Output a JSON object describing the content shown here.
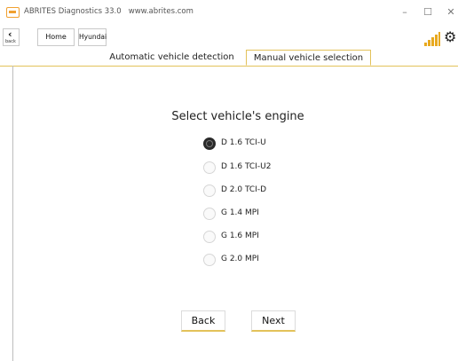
{
  "window": {
    "title": "ABRITES Diagnostics 33.0",
    "url": "www.abrites.com",
    "minimize_glyph": "–",
    "maximize_glyph": "☐",
    "close_glyph": "✕"
  },
  "toolbar": {
    "back_arrow": "‹",
    "back_label": "back",
    "home_label": "Home",
    "make_label": "Hyundai",
    "signal_icon": "signal-strength-icon",
    "settings_glyph": "⚙"
  },
  "tabs": [
    {
      "label": "Automatic vehicle detection",
      "active": false
    },
    {
      "label": "Manual vehicle selection",
      "active": true
    }
  ],
  "main": {
    "heading": "Select vehicle's engine",
    "options": [
      {
        "label": "D 1.6 TCI-U",
        "selected": true
      },
      {
        "label": "D 1.6 TCI-U2",
        "selected": false
      },
      {
        "label": "D 2.0 TCI-D",
        "selected": false
      },
      {
        "label": "G 1.4 MPI",
        "selected": false
      },
      {
        "label": "G 1.6 MPI",
        "selected": false
      },
      {
        "label": "G 2.0 MPI",
        "selected": false
      }
    ],
    "back_button": "Back",
    "next_button": "Next"
  },
  "colors": {
    "accent": "#e3c25a",
    "signal": "#e8a91f",
    "logo": "#f0a030"
  }
}
